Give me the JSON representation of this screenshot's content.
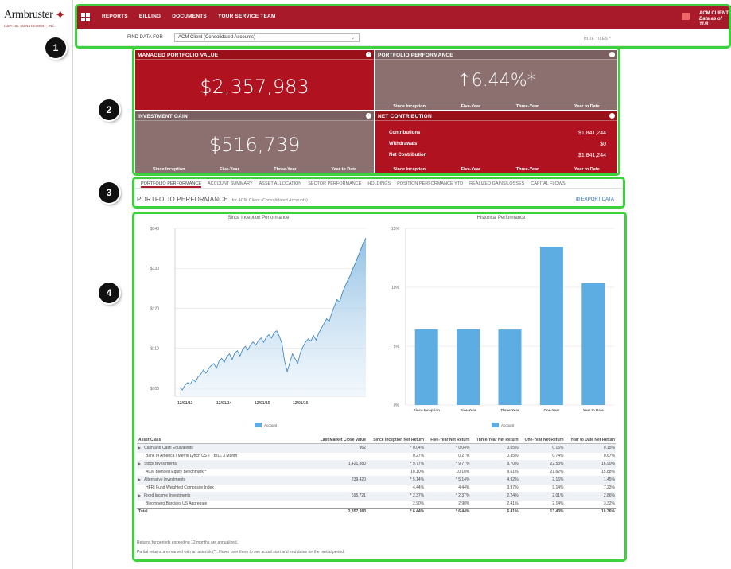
{
  "logo": {
    "word": "Armbruster",
    "sub": "CAPITAL MANAGEMENT, INC."
  },
  "nav": {
    "items": [
      "REPORTS",
      "BILLING",
      "DOCUMENTS",
      "YOUR SERVICE TEAM"
    ]
  },
  "user": {
    "name": "ACM CLIENT",
    "as_of": "Data as of 11/8"
  },
  "filter": {
    "label": "FIND DATA FOR",
    "selected": "ACM Client (Consolidated Accounts)",
    "hide_tiles": "HIDE TILES ^"
  },
  "callouts": [
    "1",
    "2",
    "3",
    "4"
  ],
  "tiles": {
    "managed": {
      "title": "MANAGED PORTFOLIO VALUE",
      "value": "$2,357,983"
    },
    "performance": {
      "title": "PORTFOLIO PERFORMANCE",
      "value": "↑6.44%*",
      "tabs": [
        "Since Inception",
        "Five-Year",
        "Three-Year",
        "Year to Date"
      ]
    },
    "gain": {
      "title": "INVESTMENT GAIN",
      "value": "$516,739",
      "tabs": [
        "Since Inception",
        "Five-Year",
        "Three-Year",
        "Year to Date"
      ]
    },
    "contribution": {
      "title": "NET CONTRIBUTION",
      "rows": [
        {
          "label": "Contributions",
          "value": "$1,841,244"
        },
        {
          "label": "Withdrawals",
          "value": "$0"
        },
        {
          "label": "Net Contribution",
          "value": "$1,841,244"
        }
      ],
      "tabs": [
        "Since Inception",
        "Five-Year",
        "Three-Year",
        "Year to Date"
      ]
    }
  },
  "section_tabs": [
    "PORTFOLIO PERFORMANCE",
    "ACCOUNT SUMMARY",
    "ASSET ALLOCATION",
    "SECTOR PERFORMANCE",
    "HOLDINGS",
    "POSITION PERFORMANCE YTD",
    "REALIZED GAINS/LOSSES",
    "CAPITAL FLOWS"
  ],
  "section": {
    "title": "PORTFOLIO PERFORMANCE",
    "subtitle": "for ACM Client (Consolidated Accounts)",
    "export": "EXPORT DATA"
  },
  "chart_data": [
    {
      "type": "area",
      "title": "Since Inception Performance",
      "y_ticks": [
        "$140",
        "$130",
        "$120",
        "$110",
        "$100"
      ],
      "ylim": [
        98,
        140
      ],
      "x_ticks": [
        "12/01/13",
        "12/01/14",
        "12/01/15",
        "12/01/16"
      ],
      "legend": "Account",
      "grid": true,
      "series": [
        {
          "values": [
            100.2,
            99.6,
            100.8,
            101.4,
            101.0,
            102.2,
            101.6,
            102.9,
            103.5,
            104.6,
            103.8,
            104.9,
            105.7,
            106.2,
            105.0,
            106.8,
            107.5,
            106.5,
            108.0,
            108.6,
            107.2,
            108.9,
            109.4,
            108.1,
            109.8,
            110.5,
            109.6,
            110.9,
            111.6,
            110.8,
            112.0,
            112.6,
            111.5,
            112.8,
            113.4,
            112.6,
            113.9,
            114.4,
            113.0,
            111.2,
            106.8,
            104.2,
            106.5,
            108.6,
            107.4,
            106.2,
            108.9,
            110.4,
            111.6,
            112.4,
            111.8,
            113.2,
            112.1,
            113.8,
            115.0,
            116.2,
            117.4,
            116.8,
            118.9,
            120.6,
            122.2,
            121.6,
            123.8,
            125.4,
            126.9,
            128.2,
            129.9,
            131.3,
            133.0,
            134.6,
            136.4,
            137.6
          ]
        }
      ]
    },
    {
      "type": "bar",
      "title": "Historical Performance",
      "categories": [
        "Since Inception",
        "Five-Year",
        "Three-Year",
        "One-Year",
        "Year to Date"
      ],
      "series": [
        {
          "values": [
            6.44,
            6.44,
            6.41,
            13.43,
            10.36
          ]
        }
      ],
      "y_ticks": [
        "15%",
        "10%",
        "5%",
        "0%"
      ],
      "ylim": [
        0,
        15
      ],
      "legend": "Account"
    }
  ],
  "table": {
    "headers": [
      "Asset Class",
      "Last Market Close Value",
      "Since Inception Net Return",
      "Five-Year Net Return",
      "Three-Year Net Return",
      "One-Year Net Return",
      "Year to Date Net Return"
    ],
    "rows": [
      {
        "kind": "group",
        "cells": [
          "Cash and Cash Equivalents",
          "962",
          "* 0.04%",
          "* 0.04%",
          "0.05%",
          "0.15%",
          "0.15%"
        ]
      },
      {
        "kind": "sub",
        "cells": [
          "Bank of America / Merrill Lynch US T - BILL 3 Month",
          "",
          "0.27%",
          "0.27%",
          "0.35%",
          "0.74%",
          "0.67%"
        ]
      },
      {
        "kind": "group",
        "cells": [
          "Stock Investments",
          "1,421,880",
          "* 9.77%",
          "* 9.77%",
          "9.70%",
          "22.53%",
          "16.90%"
        ]
      },
      {
        "kind": "sub",
        "cells": [
          "ACM Blended Equity Benchmark**",
          "",
          "10.10%",
          "10.10%",
          "9.61%",
          "21.62%",
          "15.88%"
        ]
      },
      {
        "kind": "group",
        "cells": [
          "Alternative Investments",
          "239,420",
          "* 5.14%",
          "* 5.14%",
          "4.92%",
          "2.16%",
          "1.45%"
        ]
      },
      {
        "kind": "sub",
        "cells": [
          "HFRI Fund Weighted Composite Index",
          "",
          "4.44%",
          "4.44%",
          "3.97%",
          "9.14%",
          "7.23%"
        ]
      },
      {
        "kind": "group",
        "cells": [
          "Fixed Income Investments",
          "695,721",
          "* 2.37%",
          "* 2.37%",
          "2.24%",
          "2.01%",
          "2.86%"
        ]
      },
      {
        "kind": "sub",
        "cells": [
          "Bloomberg Barclays US Aggregate",
          "",
          "2.90%",
          "2.90%",
          "2.41%",
          "2.14%",
          "3.32%"
        ]
      },
      {
        "kind": "total",
        "cells": [
          "Total",
          "2,357,983",
          "* 6.44%",
          "* 6.44%",
          "6.41%",
          "13.43%",
          "10.36%"
        ]
      }
    ]
  },
  "notes": [
    "Returns for periods exceeding 12 months are annualized.",
    "Partial returns are marked with an asterisk (*). Hover over them to see actual start and end dates for the partial period."
  ],
  "colors": {
    "brand_red": "#a8192a",
    "tile_red": "#b0131f",
    "tile_taupe": "#8c7070",
    "bar_blue": "#5dade2",
    "highlight_green": "#3cd23c"
  }
}
